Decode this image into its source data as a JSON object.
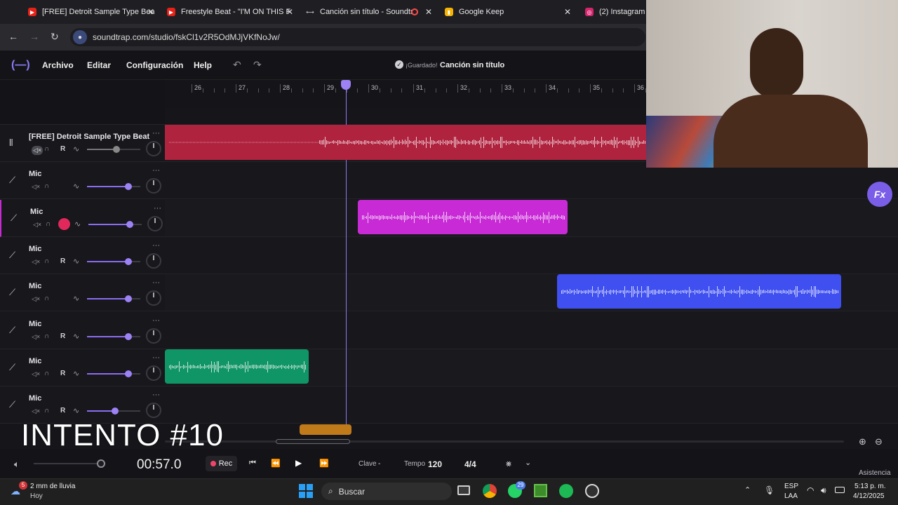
{
  "browser": {
    "tabs": [
      {
        "title": "[FREE] Detroit Sample Type Bea",
        "icon": "youtube-icon"
      },
      {
        "title": "Freestyle Beat - \"I'M ON THIS F",
        "icon": "youtube-icon"
      },
      {
        "title": "Canción sin título - Soundtr",
        "icon": "soundtrap-icon"
      },
      {
        "title": "Google Keep",
        "icon": "keep-icon"
      },
      {
        "title": "(2) Instagram",
        "icon": "instagram-icon"
      }
    ],
    "url": "soundtrap.com/studio/fskCl1v2R5OdMJjVKfNoJw/"
  },
  "app": {
    "menu": [
      "Archivo",
      "Editar",
      "Configuración",
      "Help"
    ],
    "save_status": "¡Guardado!",
    "song_title": "Canción sin título",
    "fx_label": "Fx"
  },
  "ruler": {
    "bars": [
      "26",
      "27",
      "28",
      "29",
      "30",
      "31",
      "32",
      "33",
      "34",
      "35",
      "36"
    ]
  },
  "tracks": [
    {
      "name": "[FREE] Detroit Sample Type Beat ...",
      "r_label": "R",
      "volume": 0.55,
      "type": "audio",
      "armed": false
    },
    {
      "name": "Mic",
      "r_label": "",
      "volume": 0.78,
      "type": "mic",
      "armed": false
    },
    {
      "name": "Mic",
      "r_label": "",
      "volume": 0.78,
      "type": "mic",
      "armed": true
    },
    {
      "name": "Mic",
      "r_label": "R",
      "volume": 0.78,
      "type": "mic",
      "armed": false
    },
    {
      "name": "Mic",
      "r_label": "",
      "volume": 0.78,
      "type": "mic",
      "armed": false
    },
    {
      "name": "Mic",
      "r_label": "R",
      "volume": 0.78,
      "type": "mic",
      "armed": false
    },
    {
      "name": "Mic",
      "r_label": "R",
      "volume": 0.78,
      "type": "mic",
      "armed": false
    },
    {
      "name": "Mic",
      "r_label": "R",
      "volume": 0.53,
      "type": "mic",
      "armed": false
    }
  ],
  "clips": [
    {
      "track": 0,
      "color": "#b0233f"
    },
    {
      "track": 2,
      "color": "#c82bd6"
    },
    {
      "track": 4,
      "color": "#3f4ff0"
    },
    {
      "track": 6,
      "color": "#109566"
    },
    {
      "track": 7,
      "color": "#c17a1a"
    }
  ],
  "overlay_text": "INTENTO #10",
  "transport": {
    "time": "00:57.0",
    "rec_label": "Rec",
    "key_label": "Clave",
    "key_value": "-",
    "tempo_label": "Tempo",
    "tempo_value": "120",
    "time_signature": "4/4",
    "help_label": "Asistencia"
  },
  "taskbar": {
    "weather_line1": "2 mm de lluvia",
    "weather_line2": "Hoy",
    "weather_badge": "5",
    "search_placeholder": "Buscar",
    "whatsapp_badge": "29",
    "lang1": "ESP",
    "lang2": "LAA",
    "time": "5:13 p. m.",
    "date": "4/12/2025"
  }
}
